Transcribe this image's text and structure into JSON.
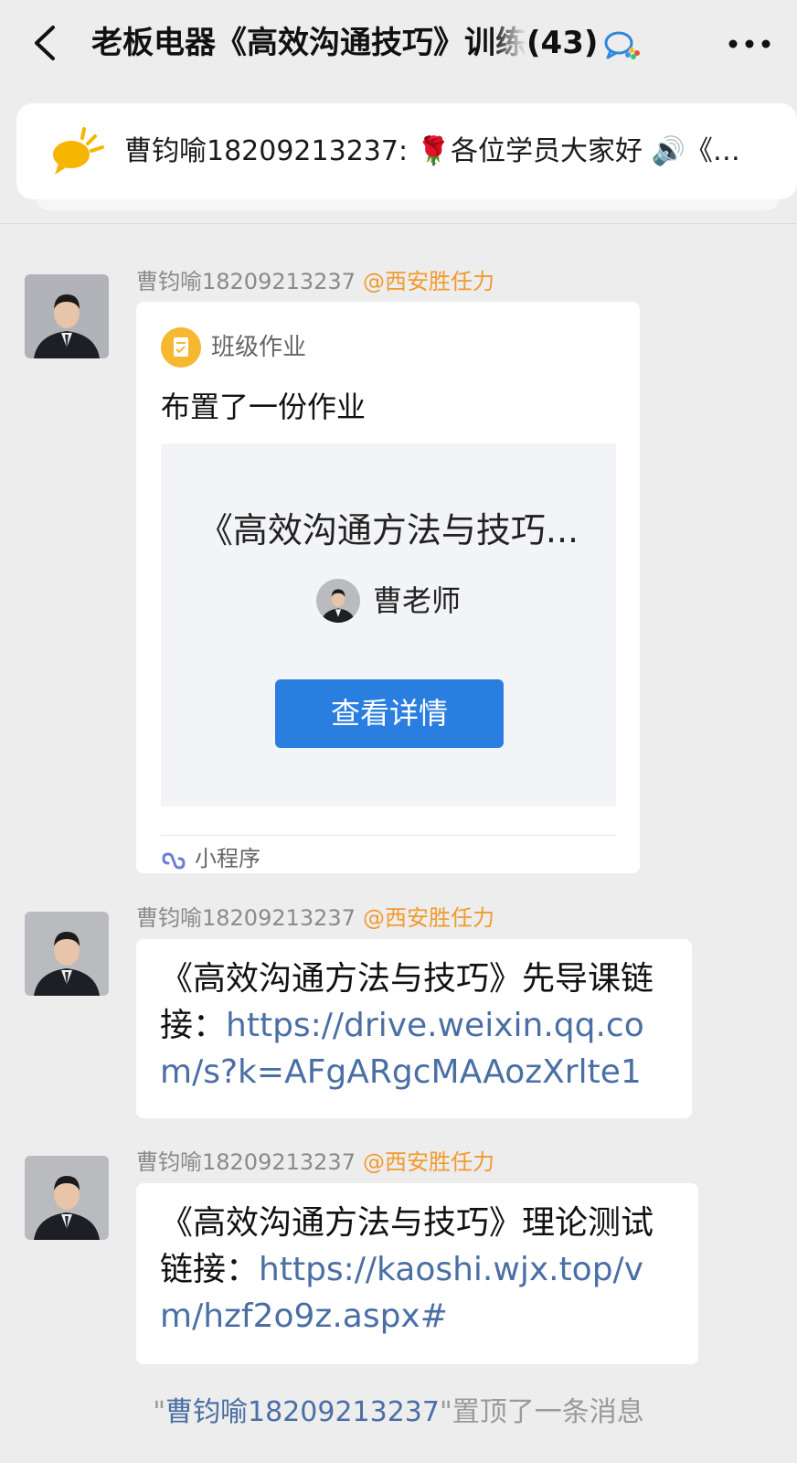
{
  "header": {
    "back_icon": "chevron-left-icon",
    "title": "老板电器《高效沟通技巧》训练",
    "member_count": "(43)",
    "wecom_icon": "wecom-chat-icon",
    "more_icon": "more-dots-icon"
  },
  "pinned": {
    "icon": "announcement-bubble-icon",
    "text": "曹钧喻18209213237: 🌹各位学员大家好 🔊《…"
  },
  "messages": [
    {
      "sender": "曹钧喻18209213237",
      "mention": "@西安胜任力",
      "type": "mini-program",
      "card": {
        "source_name": "班级作业",
        "headline": "布置了一份作业",
        "course_title": "《高效沟通方法与技巧...",
        "teacher_name": "曹老师",
        "button_label": "查看详情",
        "footer_label": "小程序"
      }
    },
    {
      "sender": "曹钧喻18209213237",
      "mention": "@西安胜任力",
      "type": "text",
      "text_prefix": "《高效沟通方法与技巧》先导课链接：",
      "link": "https://drive.weixin.qq.com/s?k=AFgARgcMAAozXrlte1"
    },
    {
      "sender": "曹钧喻18209213237",
      "mention": "@西安胜任力",
      "type": "text",
      "text_prefix": "《高效沟通方法与技巧》理论测试链接：",
      "link": "https://kaoshi.wjx.top/vm/hzf2o9z.aspx#"
    }
  ],
  "system_notice": {
    "quote_open": "\"",
    "who": "曹钧喻18209213237",
    "rest": "\"置顶了一条消息"
  },
  "colors": {
    "background": "#ededed",
    "bubble": "#ffffff",
    "mention": "#f29a2e",
    "link": "#4a6fa5",
    "primary_button": "#2a7ee0"
  }
}
